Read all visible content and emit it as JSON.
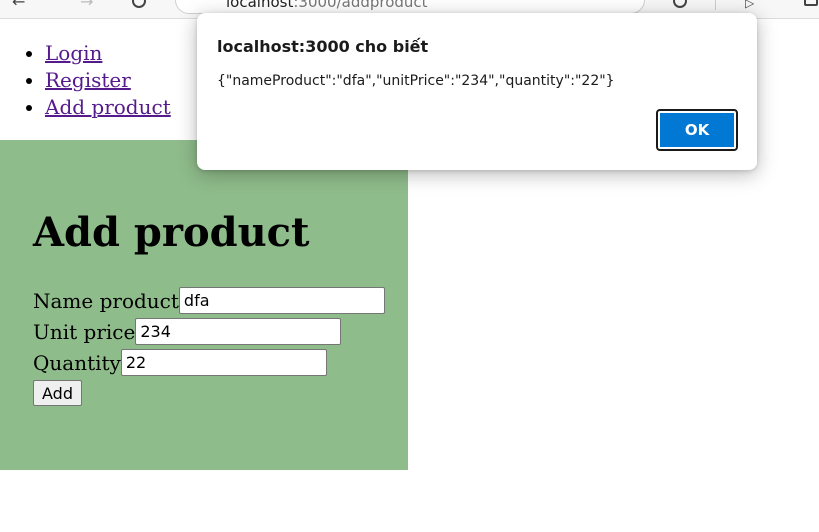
{
  "browser": {
    "address_host": "localhost",
    "address_path": ":3000/addproduct"
  },
  "nav": {
    "items": [
      "Login",
      "Register",
      "Add product"
    ]
  },
  "form": {
    "heading": "Add product",
    "name_label": "Name product",
    "name_value": "dfa",
    "price_label": "Unit price",
    "price_value": "234",
    "quantity_label": "Quantity",
    "quantity_value": "22",
    "add_button": "Add"
  },
  "dialog": {
    "title": "localhost:3000 cho biết",
    "message": "{\"nameProduct\":\"dfa\",\"unitPrice\":\"234\",\"quantity\":\"22\"}",
    "ok_label": "OK"
  },
  "colors": {
    "panel_bg": "#8fbc8b",
    "link": "#551a8b",
    "ok_button": "#0078d4"
  }
}
